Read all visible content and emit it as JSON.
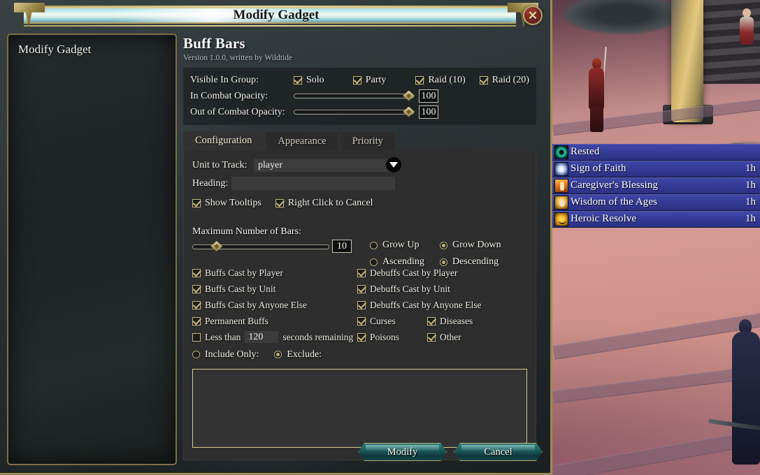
{
  "window": {
    "title": "Modify Gadget",
    "close_label": "✕"
  },
  "sidebar": {
    "items": [
      {
        "label": "Modify Gadget"
      }
    ]
  },
  "addon": {
    "name": "Buff Bars",
    "version_line": "Version 1.0.0, written by Wildtide"
  },
  "visibility": {
    "label": "Visible In Group:",
    "options": [
      {
        "label": "Solo",
        "checked": true
      },
      {
        "label": "Party",
        "checked": true
      },
      {
        "label": "Raid (10)",
        "checked": true
      },
      {
        "label": "Raid (20)",
        "checked": true
      }
    ]
  },
  "opacity": {
    "in_combat_label": "In Combat Opacity:",
    "in_combat_value": "100",
    "in_combat_percent": 96,
    "out_combat_label": "Out of Combat Opacity:",
    "out_combat_value": "100",
    "out_combat_percent": 96
  },
  "tabs": [
    {
      "label": "Configuration",
      "active": true
    },
    {
      "label": "Appearance",
      "active": false
    },
    {
      "label": "Priority",
      "active": false
    }
  ],
  "configuration": {
    "unit_to_track_label": "Unit to Track:",
    "unit_to_track_value": "player",
    "heading_label": "Heading:",
    "heading_value": "",
    "show_tooltips": {
      "label": "Show Tooltips",
      "checked": true
    },
    "right_click_cancel": {
      "label": "Right Click to Cancel",
      "checked": true
    },
    "max_bars_label": "Maximum Number of Bars:",
    "max_bars_value": "10",
    "max_bars_percent": 18,
    "grow_options": [
      {
        "label": "Grow Up",
        "selected": false
      },
      {
        "label": "Grow Down",
        "selected": true
      },
      {
        "label": "Ascending",
        "selected": false
      },
      {
        "label": "Descending",
        "selected": true
      }
    ],
    "filters_left": [
      {
        "label": "Buffs Cast by Player",
        "checked": true
      },
      {
        "label": "Buffs Cast by Unit",
        "checked": true
      },
      {
        "label": "Buffs Cast by Anyone Else",
        "checked": true
      },
      {
        "label": "Permanent Buffs",
        "checked": true
      }
    ],
    "filters_right": [
      {
        "label": "Debuffs Cast by Player",
        "checked": true
      },
      {
        "label": "Debuffs Cast by Unit",
        "checked": true
      },
      {
        "label": "Debuffs Cast by Anyone Else",
        "checked": true
      }
    ],
    "types_col1": [
      {
        "label": "Curses",
        "checked": true
      },
      {
        "label": "Poisons",
        "checked": true
      }
    ],
    "types_col2": [
      {
        "label": "Diseases",
        "checked": true
      },
      {
        "label": "Other",
        "checked": true
      }
    ],
    "less_than": {
      "checkbox_label": "Less than",
      "checked": false,
      "value": "120",
      "suffix_label": "seconds remaining"
    },
    "include_exclude": [
      {
        "label": "Include Only:",
        "selected": false
      },
      {
        "label": "Exclude:",
        "selected": true
      }
    ],
    "filter_text_value": ""
  },
  "footer": {
    "modify_label": "Modify",
    "cancel_label": "Cancel"
  },
  "buff_bars": [
    {
      "name": "Rested",
      "time": "",
      "icon": "rested-icon",
      "icon_class": "ic-rested"
    },
    {
      "name": "Sign of Faith",
      "time": "1h",
      "icon": "sign-of-faith-icon",
      "icon_class": "ic-faith"
    },
    {
      "name": "Caregiver's Blessing",
      "time": "1h",
      "icon": "caregivers-blessing-icon",
      "icon_class": "ic-care"
    },
    {
      "name": "Wisdom of the Ages",
      "time": "1h",
      "icon": "wisdom-of-the-ages-icon",
      "icon_class": "ic-wisdom"
    },
    {
      "name": "Heroic Resolve",
      "time": "1h",
      "icon": "heroic-resolve-icon",
      "icon_class": "ic-heroic"
    }
  ],
  "colors": {
    "frame_gold": "#9e8a55",
    "buff_blue": "#3a3f9c",
    "tab_active": "#323232",
    "panel_bg": "#2e2e2e",
    "textarea_border": "#d4c98e"
  }
}
